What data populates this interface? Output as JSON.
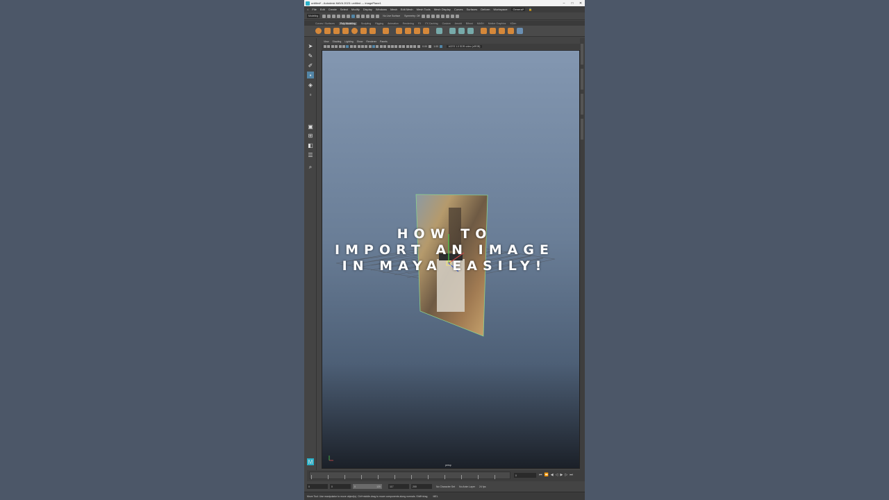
{
  "window": {
    "title": "untitled* - Autodesk MAYA 2023: untitled --- imagePlane1",
    "minimize": "–",
    "maximize": "□",
    "close": "✕"
  },
  "menubar": [
    "File",
    "Edit",
    "Create",
    "Select",
    "Modify",
    "Display",
    "Windows",
    "Mesh",
    "Edit Mesh",
    "Mesh Tools",
    "Mesh Display",
    "Curves",
    "Surfaces",
    "Deform",
    "Workspace:",
    "General*"
  ],
  "statusline": {
    "menuset": "Modeling",
    "live_surface": "No Live Surface",
    "symmetry": "Symmetry: Off"
  },
  "shelf_tabs": [
    "Curves / Surfaces",
    "Poly Modeling",
    "Sculpting",
    "Rigging",
    "Animation",
    "Rendering",
    "FX",
    "FX Caching",
    "Custom",
    "Arnold",
    "Bifrost",
    "MASH",
    "Motion Graphics",
    "XGen"
  ],
  "shelf_active_tab": "Poly Modeling",
  "panel_menu": [
    "View",
    "Shading",
    "Lighting",
    "Show",
    "Renderer",
    "Panels"
  ],
  "panel_toolbar": {
    "exposure": "0.00",
    "gamma": "1.00",
    "colorspace": "ACES 1.0 SDR-video (sRGB)"
  },
  "viewport": {
    "camera_label": "persp"
  },
  "overlay_text": [
    "HOW TO",
    "IMPORT AN IMAGE",
    "IN MAYA EASILY!"
  ],
  "timeslider": {
    "current_frame": "0"
  },
  "range": {
    "start": "0",
    "inner_start": "0",
    "inner_end": "120",
    "outer_end": "117",
    "end": "200",
    "character_set": "No Character Set",
    "anim_layer": "No Anim Layer",
    "fps": "24 fps"
  },
  "helpline": {
    "message": "Move Tool: Use manipulator to move object(s). Ctrl+middle-drag to move components along normals. Shift+drag",
    "lang": "MEL"
  },
  "colors": {
    "accent": "#5285a6",
    "shelf_icon": "#d5883a",
    "background": "#4c5768"
  }
}
